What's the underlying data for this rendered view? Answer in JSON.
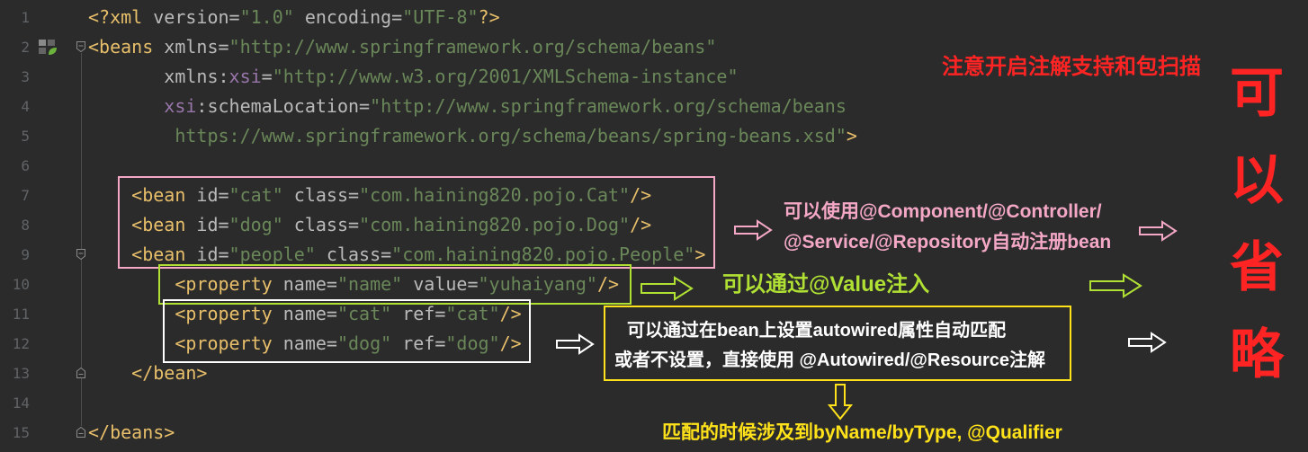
{
  "editor": {
    "lines": [
      {
        "number": 1,
        "tokens": [
          {
            "tag": "<?xml"
          },
          {
            "attr": " version="
          },
          {
            "str": "\"1.0\""
          },
          {
            "attr": " encoding="
          },
          {
            "str": "\"UTF-8\""
          },
          {
            "tag": "?>"
          }
        ]
      },
      {
        "number": 2,
        "tokens": [
          {
            "tag": "<beans"
          },
          {
            "attr": " xmlns="
          },
          {
            "str": "\"http://www.springframework.org/schema/beans\""
          }
        ]
      },
      {
        "number": 3,
        "tokens": [
          {
            "attr": "       xmlns:"
          },
          {
            "ns": "xsi"
          },
          {
            "attr": "="
          },
          {
            "str": "\"http://www.w3.org/2001/XMLSchema-instance\""
          }
        ]
      },
      {
        "number": 4,
        "tokens": [
          {
            "ns": "       xsi"
          },
          {
            "attr": ":schemaLocation="
          },
          {
            "str": "\"http://www.springframework.org/schema/beans"
          }
        ]
      },
      {
        "number": 5,
        "tokens": [
          {
            "str": "        https://www.springframework.org/schema/beans/spring-beans.xsd\""
          },
          {
            "tag": ">"
          }
        ]
      },
      {
        "number": 6,
        "tokens": []
      },
      {
        "number": 7,
        "tokens": [
          {
            "tag": "    <bean"
          },
          {
            "attr": " id="
          },
          {
            "str": "\"cat\""
          },
          {
            "attr": " class="
          },
          {
            "str": "\"com.haining820.pojo.Cat\""
          },
          {
            "tag": "/>"
          }
        ]
      },
      {
        "number": 8,
        "tokens": [
          {
            "tag": "    <bean"
          },
          {
            "attr": " id="
          },
          {
            "str": "\"dog\""
          },
          {
            "attr": " class="
          },
          {
            "str": "\"com.haining820.pojo.Dog\""
          },
          {
            "tag": "/>"
          }
        ]
      },
      {
        "number": 9,
        "tokens": [
          {
            "tag": "    <bean"
          },
          {
            "attr": " id="
          },
          {
            "str": "\"people\""
          },
          {
            "attr": " class="
          },
          {
            "str": "\"com.haining820.pojo.People\""
          },
          {
            "tag": ">"
          }
        ]
      },
      {
        "number": 10,
        "tokens": [
          {
            "tag": "        <property"
          },
          {
            "attr": " name="
          },
          {
            "str": "\"name\""
          },
          {
            "attr": " value="
          },
          {
            "str": "\"yuhaiyang\""
          },
          {
            "tag": "/>"
          }
        ]
      },
      {
        "number": 11,
        "tokens": [
          {
            "tag": "        <property"
          },
          {
            "attr": " name="
          },
          {
            "str": "\"cat\""
          },
          {
            "attr": " ref="
          },
          {
            "str": "\"cat\""
          },
          {
            "tag": "/>"
          }
        ]
      },
      {
        "number": 12,
        "tokens": [
          {
            "tag": "        <property"
          },
          {
            "attr": " name="
          },
          {
            "str": "\"dog\""
          },
          {
            "attr": " ref="
          },
          {
            "str": "\"dog\""
          },
          {
            "tag": "/>"
          }
        ]
      },
      {
        "number": 13,
        "tokens": [
          {
            "tag": "    </bean>"
          }
        ]
      },
      {
        "number": 14,
        "tokens": []
      },
      {
        "number": 15,
        "tokens": [
          {
            "tag": "</beans>"
          }
        ]
      }
    ]
  },
  "gutter": {
    "bean_icon": "spring-bean-icon",
    "fold_start_icon": "fold-start-icon",
    "fold_end_icon": "fold-end-icon"
  },
  "annotations": {
    "scan_note": "注意开启注解支持和包扫描",
    "omit_note": "可以省略",
    "component_note": {
      "line1": "可以使用@Component/@Controller/",
      "line2": "@Service/@Repository自动注册bean"
    },
    "value_note": "可以通过@Value注入",
    "autowired_note": {
      "line1": "可以通过在bean上设置autowired属性自动匹配",
      "line2": "或者不设置，直接使用 @Autowired/@Resource注解"
    },
    "qualifier_note": "匹配的时候涉及到byName/byType, @Qualifier"
  },
  "colors": {
    "background": "#2b2b2b",
    "line_number": "#606366",
    "tag": "#e8bf6a",
    "attribute": "#bababa",
    "namespace": "#9876aa",
    "string": "#6a8759",
    "annotation_red": "#ff2424",
    "annotation_pink": "#f4a8c6",
    "annotation_green": "#b0e034",
    "annotation_yellow": "#ffe21a",
    "annotation_white": "#ffffff"
  }
}
